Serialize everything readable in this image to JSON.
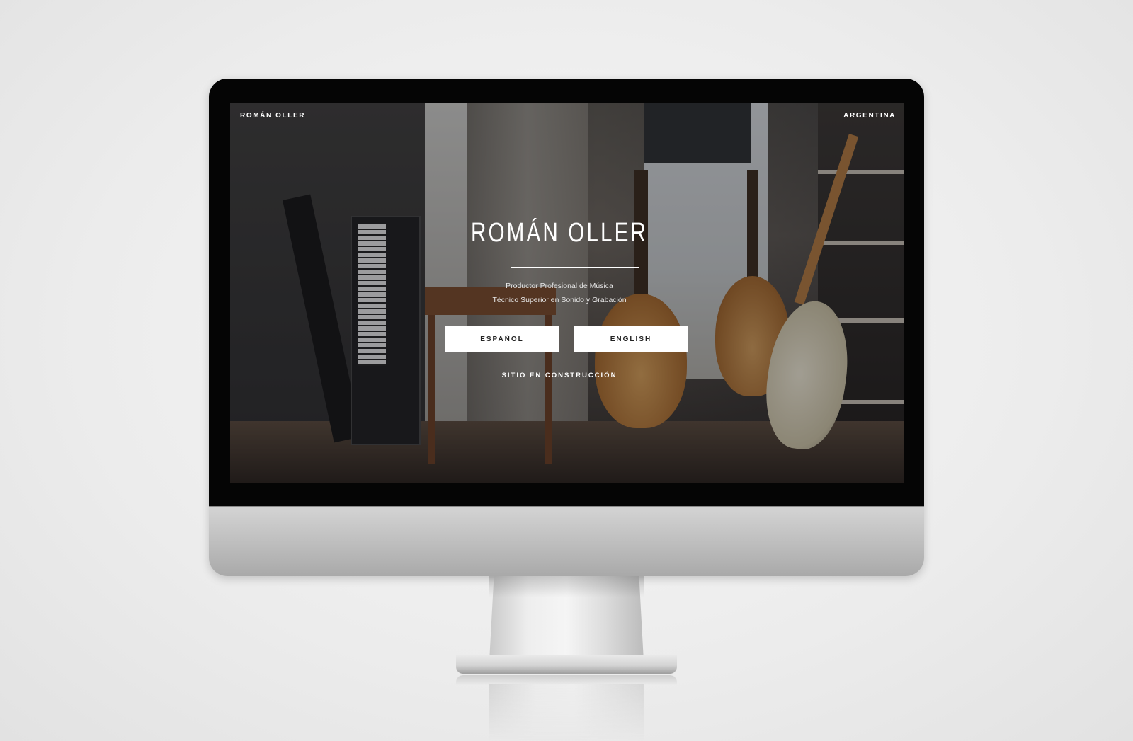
{
  "site": {
    "brand": "ROMÁN OLLER",
    "country": "ARGENTINA",
    "hero_title": "ROMÁN OLLER",
    "subtitle_line1": "Productor Profesional de Música",
    "subtitle_line2": "Técnico Superior en Sonido y Grabación",
    "buttons": {
      "espanol": "ESPAÑOL",
      "english": "ENGLISH"
    },
    "status": "SITIO EN CONSTRUCCIÓN"
  },
  "colors": {
    "button_bg": "#ffffff",
    "button_text": "#222222",
    "text": "#ffffff",
    "bezel": "#050505",
    "chin": "#bdbdbd"
  }
}
